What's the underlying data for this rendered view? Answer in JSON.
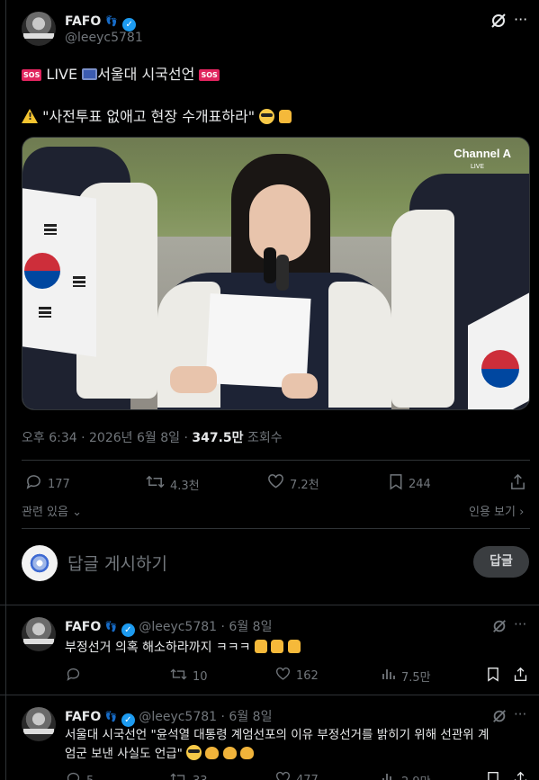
{
  "post": {
    "name": "FAFO",
    "handle": "@leeyc5781",
    "line1": {
      "sos_left": "SOS",
      "text_live": "LIVE",
      "text_title": "서울대 시국선언",
      "sos_right": "SOS"
    },
    "line2": {
      "quote": "\"사전투표 없애고 현장 수개표하라\""
    },
    "media": {
      "channel": "Channel A",
      "live": "LIVE"
    },
    "time": "오후 6:34",
    "date": "2026년 6월 8일",
    "views_count": "347.5만",
    "views_label": "조회수",
    "sep": "·",
    "stats": {
      "replies": "177",
      "reposts": "4.3천",
      "likes": "7.2천",
      "bookmarks": "244"
    },
    "related": "관련 있음",
    "quote_view": "인용 보기"
  },
  "reply_box": {
    "placeholder": "답글 게시하기",
    "button": "답글"
  },
  "replies": [
    {
      "name": "FAFO",
      "handle": "@leeyc5781",
      "date": "6월 8일",
      "text": "부정선거 의혹 해소하라까지 ㅋㅋㅋ",
      "stats": {
        "reposts": "10",
        "likes": "162",
        "views": "7.5만"
      }
    },
    {
      "name": "FAFO",
      "handle": "@leeyc5781",
      "date": "6월 8일",
      "text_line1": "서울대 시국선언 \"윤석열 대통령 계엄선포의 이유 부정선거를 밝히기 위해 선관위 계",
      "text_line2": "엄군 보낸 사실도 언급\"",
      "stats": {
        "replies": "5",
        "reposts": "33",
        "likes": "477",
        "views": "2.9만"
      }
    }
  ],
  "colors": {
    "accent": "#1d9bf0",
    "muted": "#71767b",
    "text": "#e7e9ea",
    "border": "#2f3336"
  }
}
